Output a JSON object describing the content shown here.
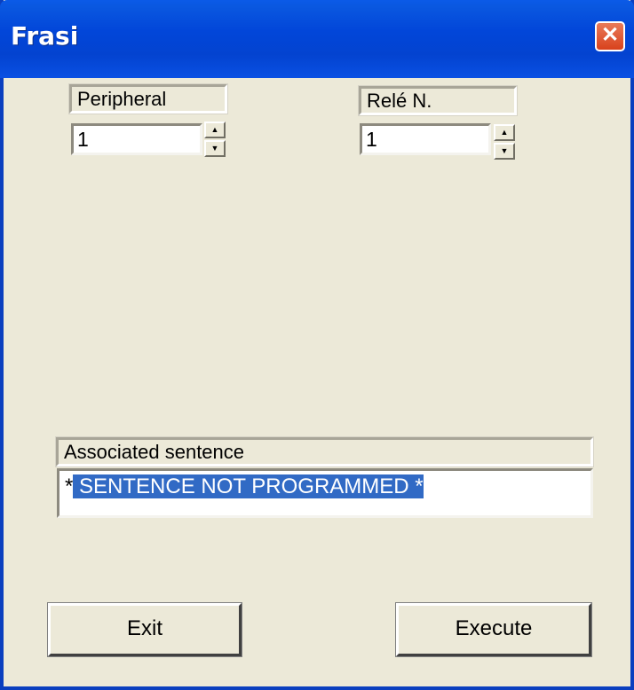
{
  "window": {
    "title": "Frasi"
  },
  "peripheral": {
    "label": "Peripheral",
    "value": "1"
  },
  "rele": {
    "label": "Relé N.",
    "value": "1"
  },
  "associated_sentence": {
    "label": "Associated sentence",
    "prefix": "*",
    "selected_text": " SENTENCE NOT PROGRAMMED *"
  },
  "buttons": {
    "exit": "Exit",
    "execute": "Execute"
  },
  "icons": {
    "close": "close-icon",
    "spin_up": "arrow-up-icon",
    "spin_down": "arrow-down-icon"
  },
  "colors": {
    "titlebar": "#0a50e3",
    "background": "#ece9d8",
    "selection": "#316ac5",
    "close": "#d8411c"
  }
}
